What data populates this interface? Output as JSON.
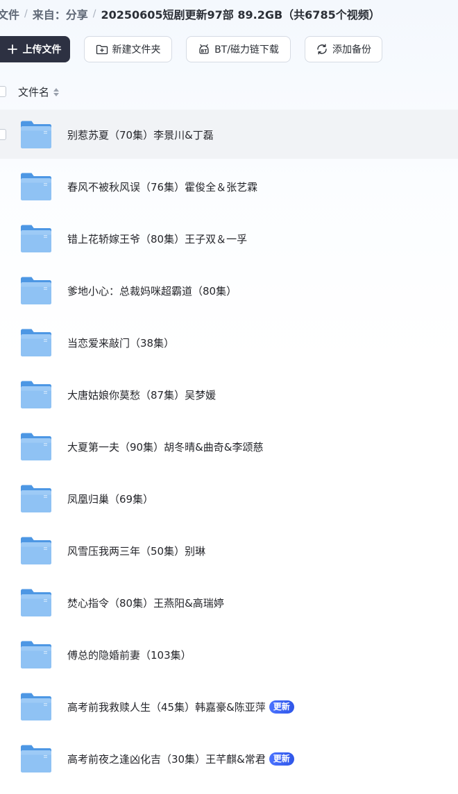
{
  "breadcrumb": {
    "root": "文件",
    "sep": "/",
    "source": "来自：分享",
    "current": "20250605短剧更新97部 89.2GB（共6785个视频）"
  },
  "toolbar": {
    "upload_label": "上传文件",
    "new_folder_label": "新建文件夹",
    "bt_label": "BT/磁力链下载",
    "backup_label": "添加备份"
  },
  "list": {
    "header_label": "文件名",
    "items": [
      {
        "name": "别惹苏夏（70集）李景川&丁磊",
        "badge": ""
      },
      {
        "name": "春风不被秋风误（76集）霍俊全＆张艺霖",
        "badge": ""
      },
      {
        "name": "错上花轿嫁王爷（80集）王子双＆一孚",
        "badge": ""
      },
      {
        "name": "爹地小心：总裁妈咪超霸道（80集）",
        "badge": ""
      },
      {
        "name": "当恋爱来敲门（38集）",
        "badge": ""
      },
      {
        "name": "大唐姑娘你莫愁（87集）吴梦媛",
        "badge": ""
      },
      {
        "name": "大夏第一夫（90集）胡冬晴&曲奇&李颂慈",
        "badge": ""
      },
      {
        "name": "凤凰归巢（69集）",
        "badge": ""
      },
      {
        "name": "风雪压我两三年（50集）别琳",
        "badge": ""
      },
      {
        "name": "焚心指令（80集）王燕阳&高瑞婷",
        "badge": ""
      },
      {
        "name": "傅总的隐婚前妻（103集）",
        "badge": ""
      },
      {
        "name": "高考前我救赎人生（45集）韩嘉豪&陈亚萍",
        "badge": "更新"
      },
      {
        "name": "高考前夜之逢凶化吉（30集）王芊麒&常君",
        "badge": "更新"
      }
    ]
  },
  "colors": {
    "primary_button": "#2d3142",
    "folder": "#5aa2ea",
    "badge": "#3b63f5",
    "hover_row": "#f1f3f6"
  },
  "icons": {
    "upload": "plus-icon",
    "new_folder": "folder-plus-icon",
    "bt": "bt-magnet-icon",
    "backup": "sync-icon",
    "sort": "sort-icon",
    "item": "folder-icon"
  }
}
